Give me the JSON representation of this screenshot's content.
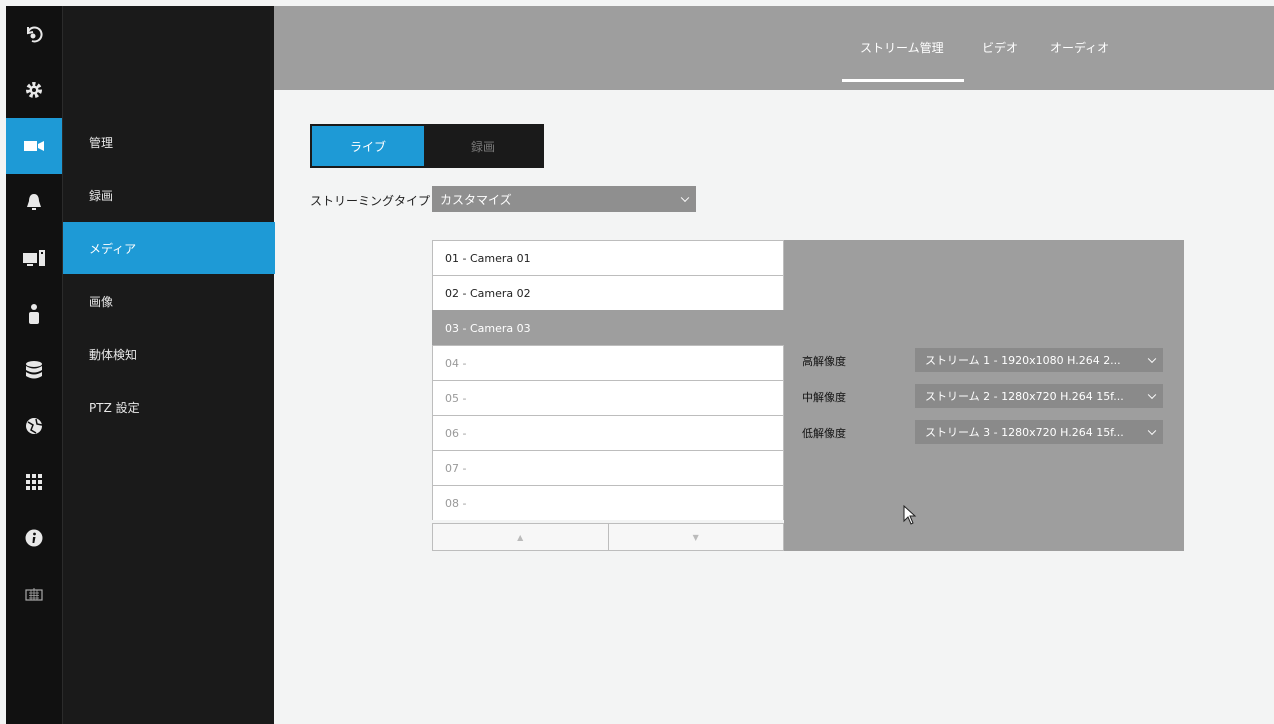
{
  "sidebar": {
    "icons": [
      "playback-icon",
      "gear-icon",
      "camera-icon",
      "bell-icon",
      "monitor-icon",
      "user-icon",
      "database-icon",
      "globe-icon",
      "grid-icon",
      "info-icon",
      "keyboard-icon"
    ],
    "active_icon": "camera-icon",
    "menu": [
      {
        "label": "管理"
      },
      {
        "label": "録画"
      },
      {
        "label": "メディア"
      },
      {
        "label": "画像"
      },
      {
        "label": "動体検知"
      },
      {
        "label": "PTZ 設定"
      }
    ],
    "active_menu_index": 2
  },
  "header": {
    "tabs": [
      {
        "label": "ストリーム管理"
      },
      {
        "label": "ビデオ"
      },
      {
        "label": "オーディオ"
      }
    ],
    "active_tab_index": 0
  },
  "mode_toggle": {
    "live_label": "ライブ",
    "record_label": "録画",
    "active": "live"
  },
  "streaming_type": {
    "label": "ストリーミングタイプ",
    "value": "カスタマイズ"
  },
  "cameras": [
    {
      "label": "01 - Camera 01",
      "state": "normal"
    },
    {
      "label": "02 - Camera 02",
      "state": "normal"
    },
    {
      "label": "03 - Camera 03",
      "state": "selected"
    },
    {
      "label": "04 -",
      "state": "dim"
    },
    {
      "label": "05 -",
      "state": "dim"
    },
    {
      "label": "06 -",
      "state": "dim"
    },
    {
      "label": "07 -",
      "state": "dim"
    },
    {
      "label": "08 -",
      "state": "dim"
    }
  ],
  "pager": {
    "up": "▲",
    "down": "▼"
  },
  "resolutions": [
    {
      "label": "高解像度",
      "value": "ストリーム 1 - 1920x1080 H.264 2..."
    },
    {
      "label": "中解像度",
      "value": "ストリーム 2 - 1280x720 H.264 15f..."
    },
    {
      "label": "低解像度",
      "value": "ストリーム 3 - 1280x720 H.264 15f..."
    }
  ],
  "colors": {
    "accent": "#1e9ad6",
    "header": "#9e9e9e",
    "sidebar": "#1a1a1a"
  }
}
